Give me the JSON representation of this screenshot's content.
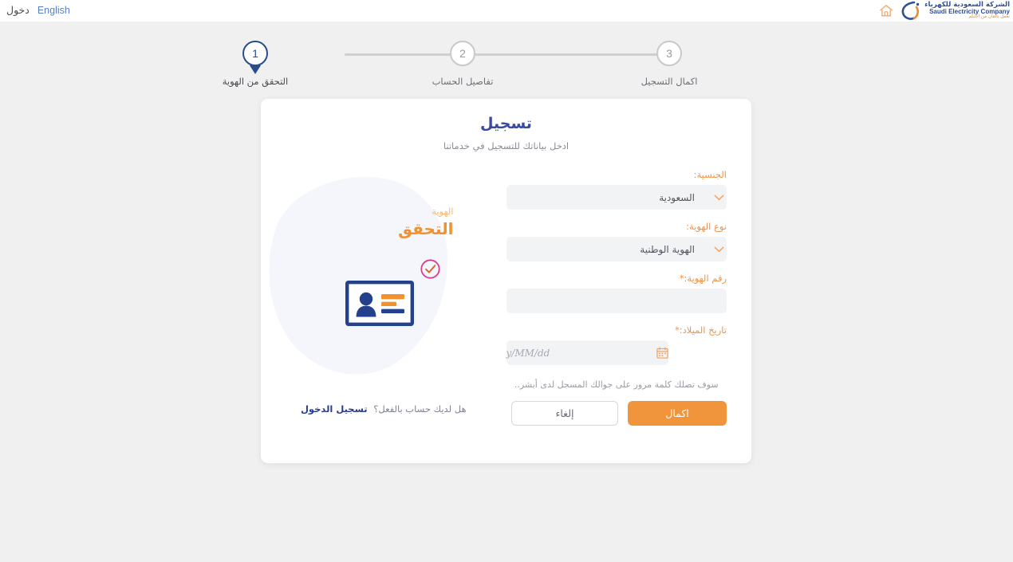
{
  "topbar": {
    "login_label": "دخول",
    "english_label": "English",
    "home_icon": "home-icon",
    "logo": {
      "arabic": "الشركة السعودية للكهرباء",
      "english": "Saudi Electricity Company",
      "tagline": "نعمل بالقان من أجلكم"
    }
  },
  "stepper": {
    "steps": [
      {
        "number": "3",
        "label": "اكمال التسجيل",
        "active": false
      },
      {
        "number": "2",
        "label": "تفاصيل الحساب",
        "active": false
      },
      {
        "number": "1",
        "label": "التحقق من الهوية",
        "active": true
      }
    ]
  },
  "card": {
    "title": "تسجيل",
    "subtitle": "ادخل بياناتك للتسجيل في خدماتنا",
    "form": {
      "nationality": {
        "label": "الجنسية:",
        "value": "السعودية",
        "icon": "chevron-down-icon"
      },
      "id_type": {
        "label": "نوع الهوية:",
        "value": "الهوية الوطنية",
        "icon": "chevron-down-icon"
      },
      "id_number": {
        "label": "رقم الهوية:",
        "required": "*",
        "value": "",
        "placeholder": ""
      },
      "birth_date": {
        "label": "تاريخ الميلاد:",
        "required": "*",
        "value": "",
        "placeholder": "y/MM/dd",
        "icon": "calendar-icon"
      },
      "hint": "سوف تصلك كلمة مرور على جوالك المسجل لدى أبشر..",
      "submit_label": "اكمال",
      "cancel_label": "إلغاء"
    },
    "art": {
      "small_text": "الهوية",
      "big_text": "التحقق",
      "check_icon": "circle-check-icon",
      "id_card_icon": "id-card-icon"
    },
    "login_prompt": {
      "question": "هل لديك حساب بالفعل؟",
      "action": "تسجيل الدخول"
    }
  },
  "colors": {
    "page_bg": "#f0f0f0",
    "accent_orange": "#f1953c",
    "accent_blue": "#2a4b8d",
    "title_blue": "#3a4a9e",
    "field_bg": "#f2f3f5",
    "blob": "#f4f6fb",
    "check_pink": "#d6408e"
  }
}
